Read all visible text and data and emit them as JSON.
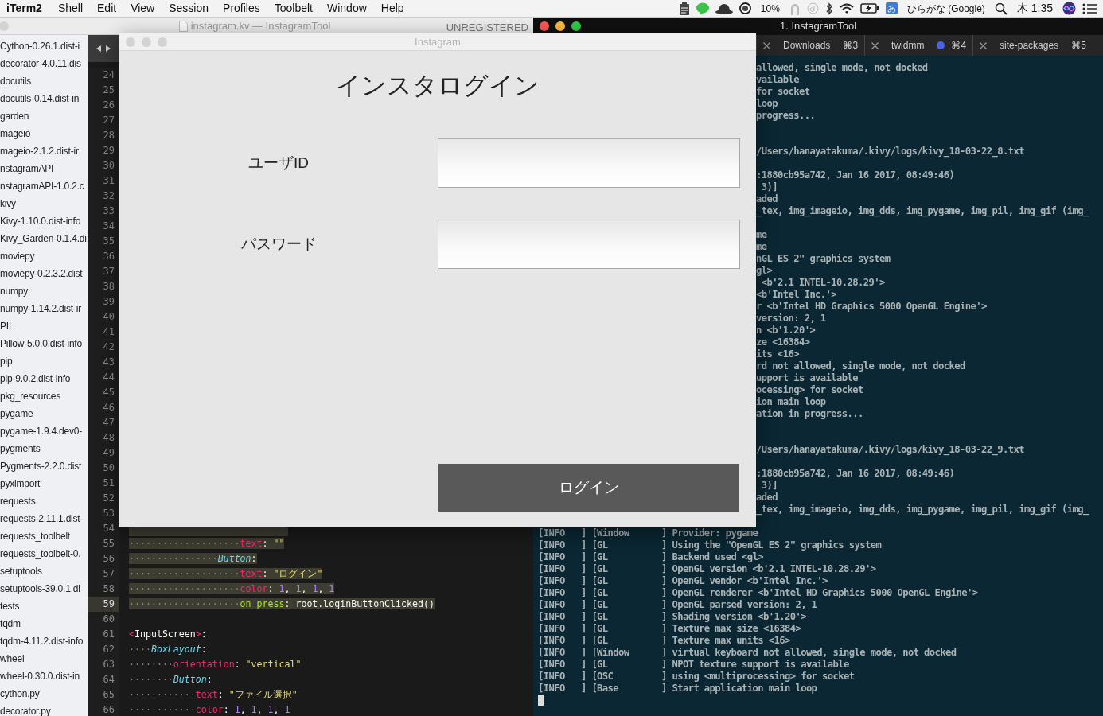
{
  "menu_bar": {
    "app": "iTerm2",
    "menus": [
      "Shell",
      "Edit",
      "View",
      "Session",
      "Profiles",
      "Toolbelt",
      "Window",
      "Help"
    ],
    "battery_percent": "10%",
    "input_method_icon": "あ",
    "input_method": "ひらがな (Google)",
    "clock": "木 1:35"
  },
  "editor": {
    "title": "instagram.kv — InstagramTool",
    "license": "UNREGISTERED",
    "sidebar": {
      "files": [
        "Cython-0.26.1.dist-i",
        "decorator-4.0.11.dis",
        "docutils",
        "docutils-0.14.dist-in",
        "garden",
        "mageio",
        "mageio-2.1.2.dist-ir",
        "nstagramAPI",
        "nstagramAPI-1.0.2.c",
        "kivy",
        "Kivy-1.10.0.dist-info",
        "Kivy_Garden-0.1.4.di",
        "moviepy",
        "moviepy-0.2.3.2.dist",
        "numpy",
        "numpy-1.14.2.dist-ir",
        "PIL",
        "Pillow-5.0.0.dist-info",
        "pip",
        "pip-9.0.2.dist-info",
        "pkg_resources",
        "pygame",
        "pygame-1.9.4.dev0-",
        "pygments",
        "Pygments-2.2.0.dist",
        "pyximport",
        "requests",
        "requests-2.11.1.dist-",
        "requests_toolbelt",
        "requests_toolbelt-0.",
        "setuptools",
        "setuptools-39.0.1.di",
        "tests",
        "tqdm",
        "tqdm-4.11.2.dist-info",
        "wheel",
        "wheel-0.30.0.dist-in",
        "cython.py",
        "decorator.py"
      ]
    },
    "lines": [
      {
        "number": "24",
        "selected": false,
        "current": false
      },
      {
        "number": "25",
        "selected": false,
        "current": false
      },
      {
        "number": "26",
        "selected": false,
        "current": false
      },
      {
        "number": "27",
        "selected": false,
        "current": false
      },
      {
        "number": "28",
        "selected": false,
        "current": false
      },
      {
        "number": "29",
        "selected": false,
        "current": false
      },
      {
        "number": "30",
        "selected": false,
        "current": false
      },
      {
        "number": "31",
        "selected": false,
        "current": false
      },
      {
        "number": "32",
        "selected": false,
        "current": false
      },
      {
        "number": "33",
        "selected": false,
        "current": false
      },
      {
        "number": "34",
        "selected": false,
        "current": false
      },
      {
        "number": "35",
        "selected": false,
        "current": false
      },
      {
        "number": "36",
        "selected": false,
        "current": false
      },
      {
        "number": "37",
        "selected": false,
        "current": false
      },
      {
        "number": "38",
        "selected": false,
        "current": false
      },
      {
        "number": "39",
        "selected": false,
        "current": false
      },
      {
        "number": "40",
        "selected": false,
        "current": false
      },
      {
        "number": "41",
        "selected": false,
        "current": false
      },
      {
        "number": "42",
        "selected": false,
        "current": false
      },
      {
        "number": "43",
        "selected": false,
        "current": false
      },
      {
        "number": "44",
        "selected": false,
        "current": false
      },
      {
        "number": "45",
        "selected": false,
        "current": false
      },
      {
        "number": "46",
        "selected": false,
        "current": false
      },
      {
        "number": "47",
        "selected": false,
        "current": false
      },
      {
        "number": "48",
        "selected": false,
        "current": false
      },
      {
        "number": "49",
        "selected": false,
        "current": false
      },
      {
        "number": "50",
        "selected": false,
        "current": false
      },
      {
        "number": "51",
        "selected": false,
        "current": false
      },
      {
        "number": "52",
        "selected": false,
        "current": false
      },
      {
        "number": "53",
        "selected": false,
        "current": false
      },
      {
        "number": "54",
        "selected": true,
        "current": false
      },
      {
        "number": "55",
        "selected": true,
        "current": false,
        "tokens": [
          {
            "kind": "indent",
            "text": "····················"
          },
          {
            "kind": "key",
            "text": "text"
          },
          {
            "kind": "punct",
            "text": ": "
          },
          {
            "kind": "string",
            "text": "\"\""
          }
        ]
      },
      {
        "number": "56",
        "selected": true,
        "current": false,
        "tokens": [
          {
            "kind": "indent",
            "text": "················"
          },
          {
            "kind": "class",
            "text": "Button"
          },
          {
            "kind": "punct",
            "text": ":"
          }
        ]
      },
      {
        "number": "57",
        "selected": true,
        "current": false,
        "tokens": [
          {
            "kind": "indent",
            "text": "····················"
          },
          {
            "kind": "key",
            "text": "text"
          },
          {
            "kind": "punct",
            "text": ": "
          },
          {
            "kind": "string",
            "text": "\"ログイン\""
          }
        ]
      },
      {
        "number": "58",
        "selected": true,
        "current": false,
        "tokens": [
          {
            "kind": "indent",
            "text": "····················"
          },
          {
            "kind": "key",
            "text": "color"
          },
          {
            "kind": "punct",
            "text": ": "
          },
          {
            "kind": "number",
            "text": "1"
          },
          {
            "kind": "punct",
            "text": ", "
          },
          {
            "kind": "number",
            "text": "1"
          },
          {
            "kind": "punct",
            "text": ", "
          },
          {
            "kind": "number",
            "text": "1"
          },
          {
            "kind": "punct",
            "text": ", "
          },
          {
            "kind": "number",
            "text": "1"
          }
        ]
      },
      {
        "number": "59",
        "selected": true,
        "current": true,
        "tokens": [
          {
            "kind": "indent",
            "text": "····················"
          },
          {
            "kind": "func",
            "text": "on_press"
          },
          {
            "kind": "punct",
            "text": ": "
          },
          {
            "kind": "plain",
            "text": "root.loginButtonClicked()"
          }
        ]
      },
      {
        "number": "60",
        "selected": false,
        "current": false
      },
      {
        "number": "61",
        "selected": false,
        "current": false,
        "tokens": [
          {
            "kind": "tag",
            "text": "<"
          },
          {
            "kind": "plain",
            "text": "InputScreen"
          },
          {
            "kind": "tag",
            "text": ">"
          },
          {
            "kind": "punct",
            "text": ":"
          }
        ]
      },
      {
        "number": "62",
        "selected": false,
        "current": false,
        "tokens": [
          {
            "kind": "indent",
            "text": "····"
          },
          {
            "kind": "class",
            "text": "BoxLayout"
          },
          {
            "kind": "punct",
            "text": ":"
          }
        ]
      },
      {
        "number": "63",
        "selected": false,
        "current": false,
        "tokens": [
          {
            "kind": "indent",
            "text": "········"
          },
          {
            "kind": "key",
            "text": "orientation"
          },
          {
            "kind": "punct",
            "text": ": "
          },
          {
            "kind": "string",
            "text": "\"vertical\""
          }
        ]
      },
      {
        "number": "64",
        "selected": false,
        "current": false,
        "tokens": [
          {
            "kind": "indent",
            "text": "········"
          },
          {
            "kind": "class",
            "text": "Button"
          },
          {
            "kind": "punct",
            "text": ":"
          }
        ]
      },
      {
        "number": "65",
        "selected": false,
        "current": false,
        "tokens": [
          {
            "kind": "indent",
            "text": "············"
          },
          {
            "kind": "key",
            "text": "text"
          },
          {
            "kind": "punct",
            "text": ": "
          },
          {
            "kind": "string",
            "text": "\"ファイル選択\""
          }
        ]
      },
      {
        "number": "66",
        "selected": false,
        "current": false,
        "tokens": [
          {
            "kind": "indent",
            "text": "············"
          },
          {
            "kind": "key",
            "text": "color"
          },
          {
            "kind": "punct",
            "text": ": "
          },
          {
            "kind": "number",
            "text": "1"
          },
          {
            "kind": "punct",
            "text": ", "
          },
          {
            "kind": "number",
            "text": "1"
          },
          {
            "kind": "punct",
            "text": ", "
          },
          {
            "kind": "number",
            "text": "1"
          },
          {
            "kind": "punct",
            "text": ", "
          },
          {
            "kind": "number",
            "text": "1"
          }
        ]
      }
    ]
  },
  "terminal": {
    "title": "1. InstagramTool",
    "tabs": [
      {
        "label": "Downloads",
        "shortcut": "⌘3",
        "activity": false
      },
      {
        "label": "twidmm",
        "shortcut": "⌘4",
        "activity": true
      },
      {
        "label": "site-packages",
        "shortcut": "⌘5",
        "activity": false
      }
    ],
    "partly_covered_lines": [
      {
        "kind": "text",
        "text": "allowed, single mode, not docked"
      },
      {
        "kind": "text",
        "text": "vailable"
      },
      {
        "kind": "text",
        "text": "for socket"
      },
      {
        "kind": "text",
        "text": "loop"
      },
      {
        "kind": "text",
        "text": "progress..."
      },
      {
        "kind": "blank"
      },
      {
        "kind": "blank"
      },
      {
        "kind": "text",
        "text": "/Users/hanayatakuma/.kivy/logs/kivy_18-03-22_8.txt"
      },
      {
        "kind": "blank"
      },
      {
        "kind": "text",
        "text": ":1880cb95a742, Jan 16 2017, 08:49:46)"
      },
      {
        "kind": "text",
        "text": " 3)]"
      },
      {
        "kind": "text",
        "text": "aded"
      },
      {
        "kind": "text",
        "text": "_tex, img_imageio, img_dds, img_pygame, img_pil, img_gif (img_"
      },
      {
        "kind": "blank"
      },
      {
        "kind": "text",
        "text": "me"
      },
      {
        "kind": "text",
        "text": "me"
      },
      {
        "kind": "text",
        "text": "nGL ES 2\" graphics system"
      },
      {
        "kind": "text",
        "text": "gl>"
      },
      {
        "kind": "text",
        "text": " <b'2.1 INTEL-10.28.29'>"
      },
      {
        "kind": "text",
        "text": "<b'Intel Inc.'>"
      },
      {
        "kind": "text",
        "text": "r <b'Intel HD Graphics 5000 OpenGL Engine'>"
      },
      {
        "kind": "text",
        "text": "version: 2, 1"
      },
      {
        "kind": "text",
        "text": "n <b'1.20'>"
      },
      {
        "kind": "text",
        "text": "ze <16384>"
      },
      {
        "kind": "text",
        "text": "its <16>"
      },
      {
        "kind": "text",
        "text": "rd not allowed, single mode, not docked"
      },
      {
        "kind": "text",
        "text": "upport is available"
      },
      {
        "kind": "text",
        "text": "ocessing> for socket"
      },
      {
        "kind": "text",
        "text": "ion main loop"
      },
      {
        "kind": "text",
        "text": "ation in progress..."
      },
      {
        "kind": "blank"
      },
      {
        "kind": "blank"
      },
      {
        "kind": "text",
        "text": "/Users/hanayatakuma/.kivy/logs/kivy_18-03-22_9.txt"
      },
      {
        "kind": "blank"
      },
      {
        "kind": "text",
        "text": ":1880cb95a742, Jan 16 2017, 08:49:46)"
      },
      {
        "kind": "text",
        "text": " 3)]"
      },
      {
        "kind": "text",
        "text": "aded"
      },
      {
        "kind": "text",
        "text": "_tex, img_imageio, img_dds, img_pygame, img_pil, img_gif (img_"
      },
      {
        "kind": "blank"
      }
    ],
    "lines": [
      "[INFO   ] [Window      ] Provider: pygame",
      "[INFO   ] [GL          ] Using the \"OpenGL ES 2\" graphics system",
      "[INFO   ] [GL          ] Backend used <gl>",
      "[INFO   ] [GL          ] OpenGL version <b'2.1 INTEL-10.28.29'>",
      "[INFO   ] [GL          ] OpenGL vendor <b'Intel Inc.'>",
      "[INFO   ] [GL          ] OpenGL renderer <b'Intel HD Graphics 5000 OpenGL Engine'>",
      "[INFO   ] [GL          ] OpenGL parsed version: 2, 1",
      "[INFO   ] [GL          ] Shading version <b'1.20'>",
      "[INFO   ] [GL          ] Texture max size <16384>",
      "[INFO   ] [GL          ] Texture max units <16>",
      "[INFO   ] [Window      ] virtual keyboard not allowed, single mode, not docked",
      "[INFO   ] [GL          ] NPOT texture support is available",
      "[INFO   ] [OSC         ] using <multiprocessing> for socket",
      "[INFO   ] [Base        ] Start application main loop"
    ]
  },
  "app_window": {
    "title": "Instagram",
    "heading": "インスタログイン",
    "fields": [
      {
        "label": "ユーザID"
      },
      {
        "label": "パスワード"
      }
    ],
    "button": "ログイン"
  }
}
